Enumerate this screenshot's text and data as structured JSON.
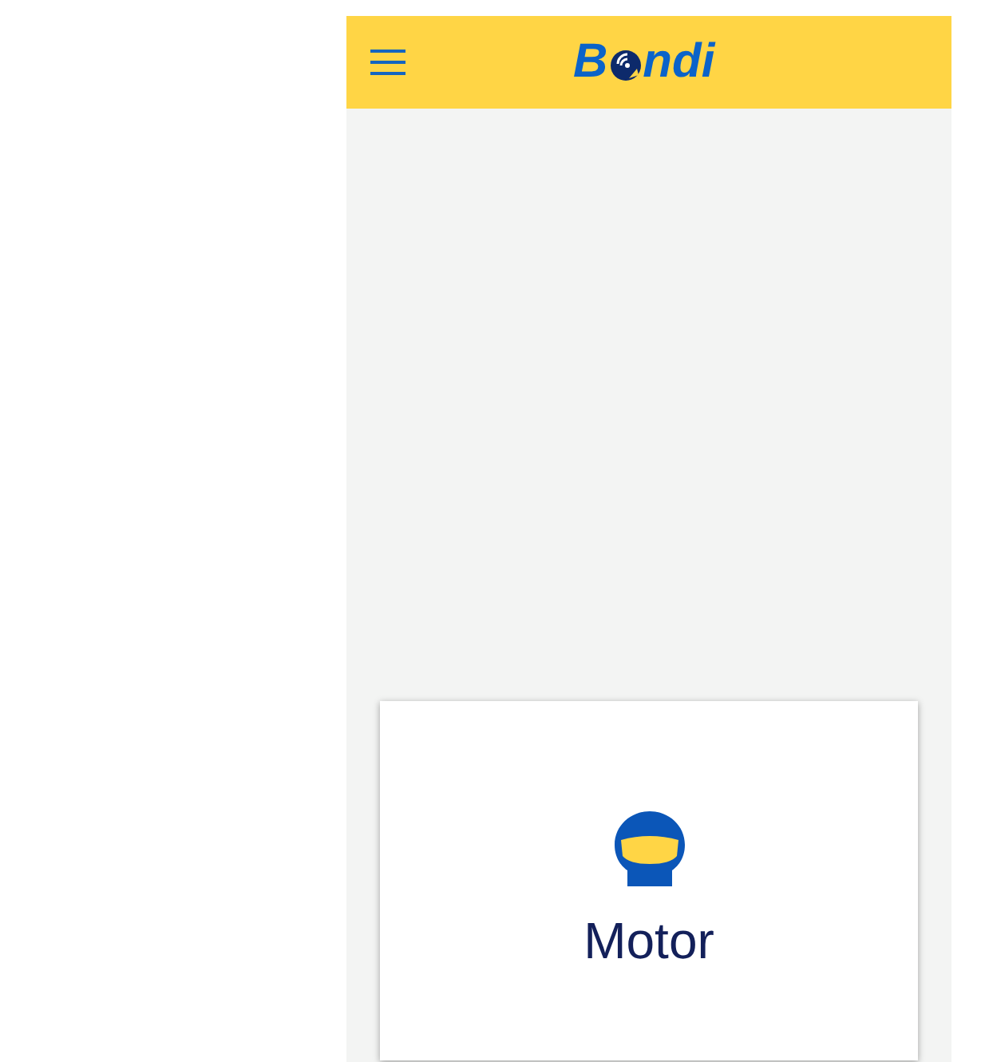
{
  "header": {
    "logo": {
      "before": "B",
      "after": "ndi"
    }
  },
  "cards": [
    {
      "label": "Motor"
    }
  ]
}
